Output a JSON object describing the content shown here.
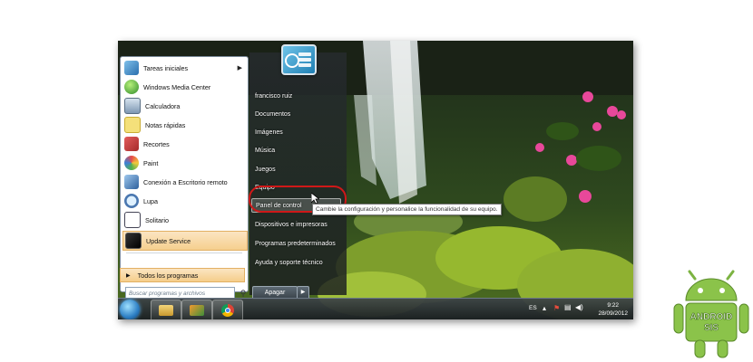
{
  "start_menu": {
    "programs": [
      {
        "label": "Tareas iniciales",
        "icon": "getting-started-icon",
        "has_arrow": true
      },
      {
        "label": "Windows Media Center",
        "icon": "media-center-icon",
        "has_arrow": false
      },
      {
        "label": "Calculadora",
        "icon": "calculator-icon",
        "has_arrow": false
      },
      {
        "label": "Notas rápidas",
        "icon": "sticky-notes-icon",
        "has_arrow": false
      },
      {
        "label": "Recortes",
        "icon": "snipping-tool-icon",
        "has_arrow": false
      },
      {
        "label": "Paint",
        "icon": "paint-icon",
        "has_arrow": false
      },
      {
        "label": "Conexión a Escritorio remoto",
        "icon": "remote-desktop-icon",
        "has_arrow": false
      },
      {
        "label": "Lupa",
        "icon": "magnifier-icon",
        "has_arrow": false
      },
      {
        "label": "Solitario",
        "icon": "solitaire-icon",
        "has_arrow": false
      },
      {
        "label": "Update Service",
        "icon": "update-service-icon",
        "has_arrow": false
      }
    ],
    "all_programs_label": "Todos los programas",
    "search_placeholder": "Buscar programas y archivos",
    "right_items": [
      {
        "label": "francisco ruiz"
      },
      {
        "label": "Documentos"
      },
      {
        "label": "Imágenes"
      },
      {
        "label": "Música"
      },
      {
        "label": "Juegos"
      },
      {
        "label": "Equipo"
      },
      {
        "label": "Panel de control"
      },
      {
        "label": "Dispositivos e impresoras"
      },
      {
        "label": "Programas predeterminados"
      },
      {
        "label": "Ayuda y soporte técnico"
      }
    ],
    "shutdown_label": "Apagar"
  },
  "tooltip": "Cambie la configuración y personalice la funcionalidad de su equipo.",
  "taskbar": {
    "language": "ES",
    "time": "9:22",
    "date": "28/09/2012",
    "pinned": [
      "explorer-icon",
      "media-player-icon",
      "chrome-icon"
    ]
  },
  "watermark": {
    "text": "ANDROID SIS",
    "color": "#8bc34a"
  },
  "colors": {
    "highlight": "#f6cf8e",
    "selection_ring": "#d01818",
    "taskbar": "#2a3036"
  }
}
